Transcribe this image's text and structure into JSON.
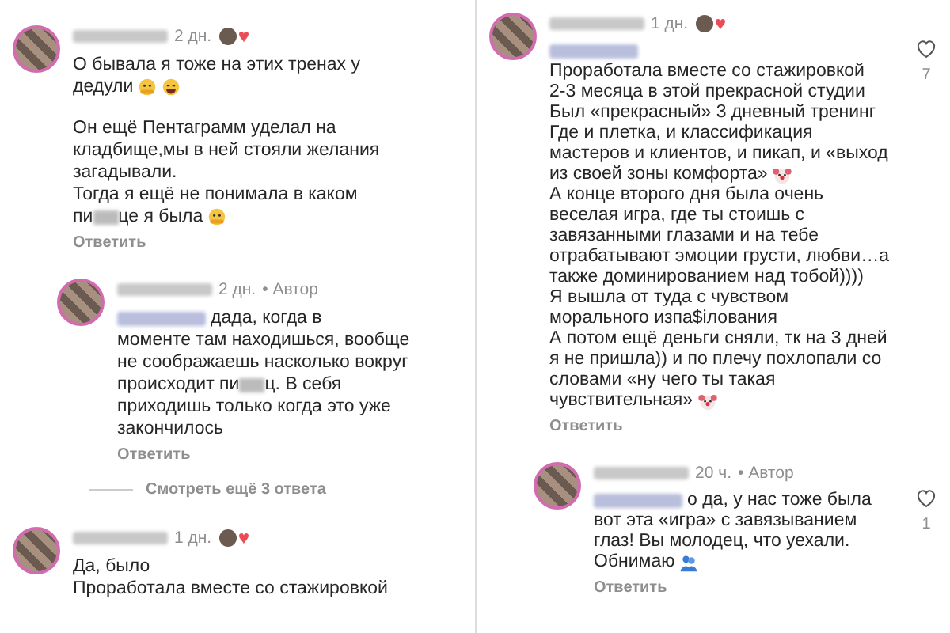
{
  "panels": [
    {
      "comments": [
        {
          "time": "2 дн.",
          "creator_liked": true,
          "body": [
            [
              [
                {
                  "kind": "text",
                  "text": "О бывала я тоже на этих тренах у"
                }
              ],
              [
                {
                  "kind": "text",
                  "text": "дедули"
                },
                {
                  "kind": "hug"
                },
                {
                  "kind": "laugh"
                }
              ]
            ],
            [
              [
                {
                  "kind": "text",
                  "text": "Он ещё Пентаграмм уделал на"
                }
              ],
              [
                {
                  "kind": "text",
                  "text": "кладбище,мы в ней стояли желания"
                }
              ],
              [
                {
                  "kind": "text",
                  "text": "загадывали."
                }
              ],
              [
                {
                  "kind": "text",
                  "text": "Тогда я ещё не понимала в каком"
                }
              ],
              [
                {
                  "kind": "text",
                  "text": "пи"
                },
                {
                  "kind": "blur"
                },
                {
                  "kind": "text",
                  "text": "це я была"
                },
                {
                  "kind": "hug"
                }
              ]
            ]
          ],
          "reply_link": "Ответить",
          "replies": [
            {
              "time": "2 дн.",
              "author_tag": "• Автор",
              "body": [
                [
                  [
                    {
                      "kind": "blur"
                    },
                    {
                      "kind": "text",
                      "text": "дада, когда в"
                    }
                  ],
                  [
                    {
                      "kind": "text",
                      "text": "моменте там находишься, вообще"
                    }
                  ],
                  [
                    {
                      "kind": "text",
                      "text": "не соображаешь насколько вокруг"
                    }
                  ],
                  [
                    {
                      "kind": "text",
                      "text": "происходит пи"
                    },
                    {
                      "kind": "blur"
                    },
                    {
                      "kind": "text",
                      "text": "ц. В себя"
                    }
                  ],
                  [
                    {
                      "kind": "text",
                      "text": "приходишь только когда это уже"
                    }
                  ],
                  [
                    {
                      "kind": "text",
                      "text": "закончилось"
                    }
                  ]
                ]
              ],
              "reply_link": "Ответить"
            }
          ],
          "view_more": "Смотреть ещё 3 ответа"
        },
        {
          "time": "1 дн.",
          "creator_liked": true,
          "body": [
            [
              [
                {
                  "kind": "text",
                  "text": "Да, было"
                }
              ],
              [
                {
                  "kind": "text",
                  "text": "Проработала вместе со стажировкой"
                }
              ]
            ]
          ]
        }
      ]
    },
    {
      "comments": [
        {
          "time": "1 дн.",
          "creator_liked": true,
          "likes": "7",
          "body": [
            [
              [
                {
                  "kind": "blur"
                }
              ],
              [
                {
                  "kind": "text",
                  "text": "Проработала вместе со стажировкой"
                }
              ],
              [
                {
                  "kind": "text",
                  "text": "2-3 месяца в этой прекрасной студии"
                }
              ],
              [
                {
                  "kind": "text",
                  "text": "Был «прекрасный» 3 дневный тренинг"
                }
              ],
              [
                {
                  "kind": "text",
                  "text": "Где и плетка, и классификация"
                }
              ],
              [
                {
                  "kind": "text",
                  "text": "мастеров и клиентов, и пикап, и «выход"
                }
              ],
              [
                {
                  "kind": "text",
                  "text": "из своей зоны комфорта»"
                },
                {
                  "kind": "clown"
                }
              ],
              [
                {
                  "kind": "text",
                  "text": "А конце второго дня была очень"
                }
              ],
              [
                {
                  "kind": "text",
                  "text": "веселая игра, где ты стоишь с"
                }
              ],
              [
                {
                  "kind": "text",
                  "text": "завязанными глазами и на тебе"
                }
              ],
              [
                {
                  "kind": "text",
                  "text": "отрабатывают эмоции грусти, любви…а"
                }
              ],
              [
                {
                  "kind": "text",
                  "text": "также доминированием над тобой))))"
                }
              ],
              [
                {
                  "kind": "text",
                  "text": "Я вышла от туда с чувством"
                }
              ],
              [
                {
                  "kind": "text",
                  "text": "морального изпа$ілования"
                }
              ],
              [
                {
                  "kind": "text",
                  "text": "А потом ещё деньги сняли, тк на 3 дней"
                }
              ],
              [
                {
                  "kind": "text",
                  "text": "я не пришла)) и по плечу похлопали со"
                }
              ],
              [
                {
                  "kind": "text",
                  "text": "словами «ну чего ты такая"
                }
              ],
              [
                {
                  "kind": "text",
                  "text": "чувствительная»"
                },
                {
                  "kind": "clown"
                }
              ]
            ]
          ],
          "reply_link": "Ответить",
          "replies": [
            {
              "time": "20 ч.",
              "author_tag": "• Автор",
              "likes": "1",
              "body": [
                [
                  [
                    {
                      "kind": "blur"
                    },
                    {
                      "kind": "text",
                      "text": "о да, у нас тоже была"
                    }
                  ],
                  [
                    {
                      "kind": "text",
                      "text": "вот эта «игра» с завязыванием"
                    }
                  ],
                  [
                    {
                      "kind": "text",
                      "text": "глаз! Вы молодец, что уехали."
                    }
                  ],
                  [
                    {
                      "kind": "text",
                      "text": "Обнимаю"
                    },
                    {
                      "kind": "people"
                    }
                  ]
                ]
              ],
              "reply_link": "Ответить"
            }
          ]
        }
      ]
    }
  ]
}
